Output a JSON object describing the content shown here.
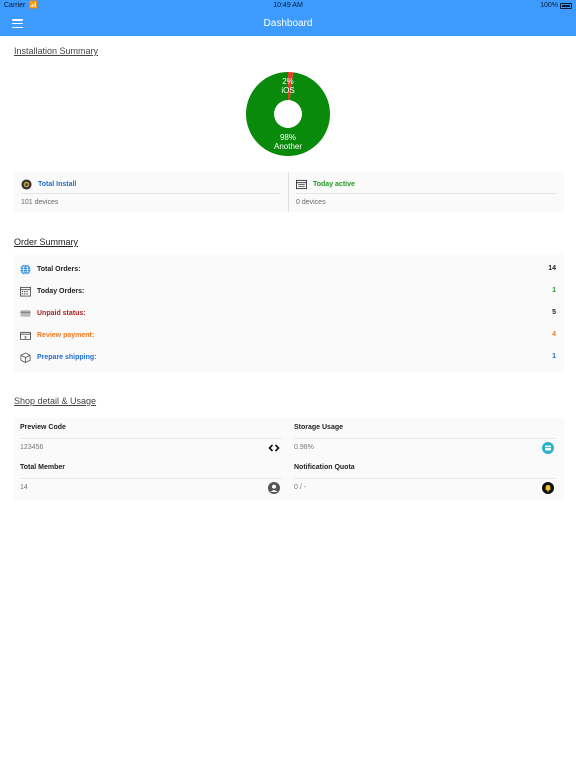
{
  "status_bar": {
    "carrier": "Carrier",
    "time": "10:49 AM",
    "battery": "100%"
  },
  "nav": {
    "title": "Dashboard"
  },
  "installation": {
    "title": "Installation Summary",
    "chart_data": {
      "type": "pie",
      "categories": [
        "iOS",
        "Another"
      ],
      "values": [
        2,
        98
      ],
      "value_labels": [
        "2%",
        "98%"
      ],
      "colors": [
        "#e0402a",
        "#0a8a0a"
      ]
    },
    "total_install": {
      "label": "Total Install",
      "value": "101 devices",
      "color": "#1e6fd0"
    },
    "today_active": {
      "label": "Today active",
      "value": "0 devices",
      "color": "#1e9a1e"
    }
  },
  "orders": {
    "title": "Order Summary",
    "items": [
      {
        "label": "Total Orders:",
        "value": "14",
        "color": "#222222",
        "icon": "globe-icon"
      },
      {
        "label": "Today Orders:",
        "value": "1",
        "color": "#222222",
        "value_color": "#1e9a1e",
        "icon": "calendar-icon"
      },
      {
        "label": "Unpaid status:",
        "value": "5",
        "color": "#b02020",
        "icon": "card-icon"
      },
      {
        "label": "Review payment:",
        "value": "4",
        "color": "#f07a20",
        "icon": "wallet-icon"
      },
      {
        "label": "Prepare shipping:",
        "value": "1",
        "color": "#1e6fd0",
        "icon": "box-icon"
      }
    ]
  },
  "shop": {
    "title": "Shop detail & Usage",
    "preview_code": {
      "label": "Preview Code",
      "value": "123456"
    },
    "storage_usage": {
      "label": "Storage Usage",
      "value": "0.98%"
    },
    "total_member": {
      "label": "Total Member",
      "value": "14"
    },
    "notification_quota": {
      "label": "Notification Quota",
      "value": "0 / -"
    }
  }
}
